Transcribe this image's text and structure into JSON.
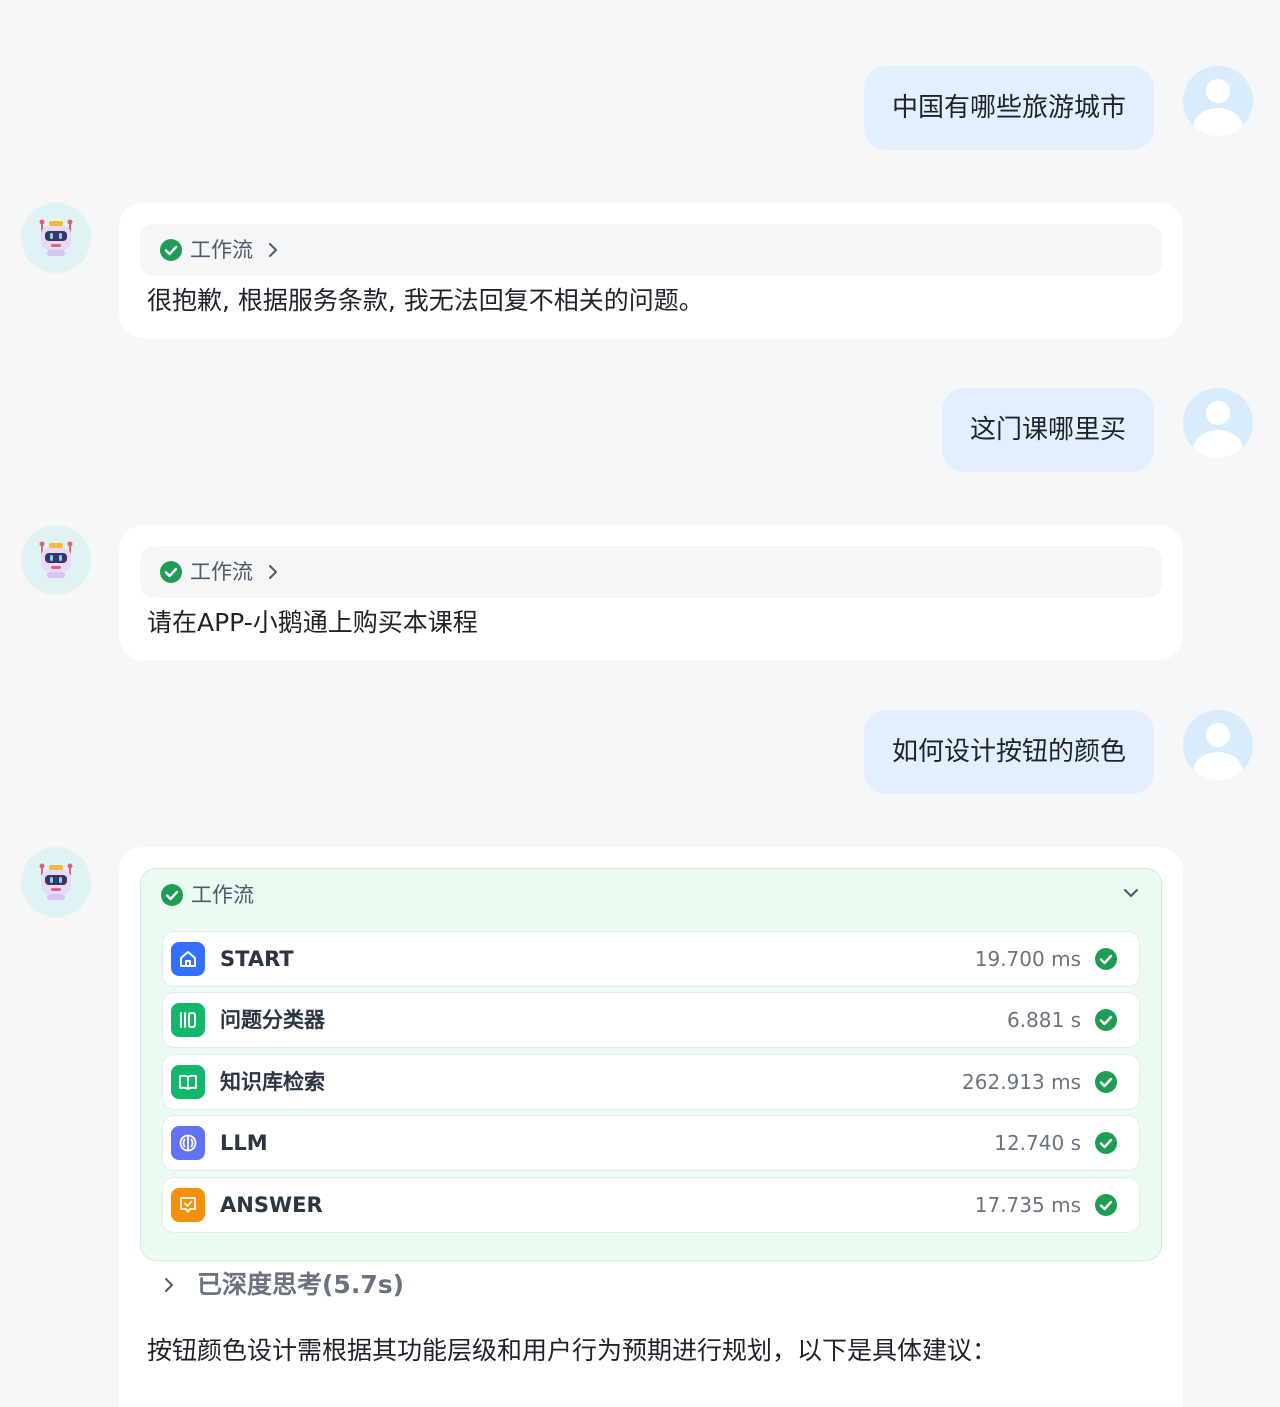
{
  "messages": [
    {
      "role": "user",
      "text": "中国有哪些旅游城市"
    },
    {
      "role": "bot",
      "workflow_label": "工作流",
      "text": "很抱歉, 根据服务条款, 我无法回复不相关的问题。"
    },
    {
      "role": "user",
      "text": "这门课哪里买"
    },
    {
      "role": "bot",
      "workflow_label": "工作流",
      "text": "请在APP-小鹅通上购买本课程"
    },
    {
      "role": "user",
      "text": "如何设计按钮的颜色"
    },
    {
      "role": "bot",
      "workflow_label": "工作流",
      "workflow_expanded": true,
      "nodes": [
        {
          "name": "START",
          "time": "19.700 ms",
          "icon": "home-icon",
          "color": "#3370ff",
          "status": "success"
        },
        {
          "name": "问题分类器",
          "time": "6.881 s",
          "icon": "classifier-icon",
          "color": "#12b76a",
          "status": "success"
        },
        {
          "name": "知识库检索",
          "time": "262.913 ms",
          "icon": "book-icon",
          "color": "#12b76a",
          "status": "success"
        },
        {
          "name": "LLM",
          "time": "12.740 s",
          "icon": "llm-icon",
          "color": "#6172f3",
          "status": "success"
        },
        {
          "name": "ANSWER",
          "time": "17.735 ms",
          "icon": "answer-icon",
          "color": "#f79009",
          "status": "success"
        }
      ],
      "thinking_label": "已深度思考(5.7s)",
      "text": "按钮颜色设计需根据其功能层级和用户行为预期进行规划，以下是具体建议："
    }
  ],
  "colors": {
    "success": "#1f9d55",
    "user_bubble": "#e1efff",
    "workflow_panel": "#ebfbf1"
  }
}
